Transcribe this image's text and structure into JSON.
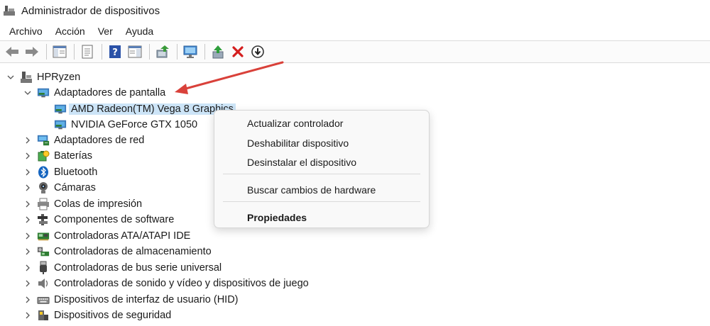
{
  "window": {
    "title": "Administrador de dispositivos"
  },
  "menu": [
    {
      "label": "Archivo"
    },
    {
      "label": "Acción"
    },
    {
      "label": "Ver"
    },
    {
      "label": "Ayuda"
    }
  ],
  "toolbar": {
    "icons": [
      "back-arrow-icon",
      "forward-arrow-icon",
      "console-tree-icon",
      "properties-icon",
      "help-icon",
      "action-pane-icon",
      "update-driver-icon",
      "scan-hardware-icon",
      "enable-device-icon",
      "uninstall-device-icon",
      "download-icon"
    ]
  },
  "tree": {
    "root": {
      "label": "HPRyzen",
      "icon": "computer-icon"
    },
    "expanded_category": {
      "label": "Adaptadores de pantalla",
      "icon": "monitor-icon",
      "children": [
        {
          "label": "AMD Radeon(TM) Vega 8 Graphics",
          "selected": true
        },
        {
          "label": "NVIDIA GeForce GTX 1050",
          "selected": false
        }
      ]
    },
    "categories": [
      {
        "label": "Adaptadores de red",
        "icon": "network-adapter-icon"
      },
      {
        "label": "Baterías",
        "icon": "battery-icon"
      },
      {
        "label": "Bluetooth",
        "icon": "bluetooth-icon"
      },
      {
        "label": "Cámaras",
        "icon": "camera-icon"
      },
      {
        "label": "Colas de impresión",
        "icon": "printer-icon"
      },
      {
        "label": "Componentes de software",
        "icon": "software-component-icon"
      },
      {
        "label": "Controladoras ATA/ATAPI IDE",
        "icon": "ide-controller-icon"
      },
      {
        "label": "Controladoras de almacenamiento",
        "icon": "storage-controller-icon"
      },
      {
        "label": "Controladoras de bus serie universal",
        "icon": "usb-icon"
      },
      {
        "label": "Controladoras de sonido y vídeo y dispositivos de juego",
        "icon": "speaker-icon"
      },
      {
        "label": "Dispositivos de interfaz de usuario (HID)",
        "icon": "keyboard-icon"
      },
      {
        "label": "Dispositivos de seguridad",
        "icon": "security-device-icon"
      }
    ]
  },
  "context_menu": {
    "items": [
      {
        "label": "Actualizar controlador"
      },
      {
        "label": "Deshabilitar dispositivo"
      },
      {
        "label": "Desinstalar el dispositivo"
      },
      {
        "label": "Buscar cambios de hardware"
      },
      {
        "label": "Propiedades"
      }
    ]
  },
  "colors": {
    "selection": "#cce4f7",
    "annotation_arrow": "#d9413a"
  }
}
